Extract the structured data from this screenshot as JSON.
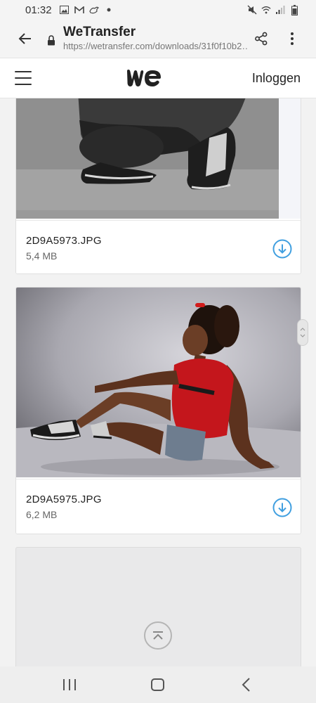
{
  "status_bar": {
    "time": "01:32",
    "icons": [
      "image-icon",
      "gmail-icon",
      "bird-icon",
      "dot-icon",
      "mute-icon",
      "wifi-icon",
      "signal-icon",
      "battery-icon"
    ]
  },
  "browser": {
    "title": "WeTransfer",
    "url": "https://wetransfer.com/downloads/31f0f10b2…"
  },
  "header": {
    "logo_alt": "we",
    "login_label": "Inloggen"
  },
  "files": [
    {
      "name": "2D9A5973.JPG",
      "size": "5,4 MB"
    },
    {
      "name": "2D9A5975.JPG",
      "size": "6,2 MB"
    }
  ],
  "colors": {
    "accent": "#409fe0",
    "background": "#f2f2f2",
    "card": "#ffffff"
  }
}
